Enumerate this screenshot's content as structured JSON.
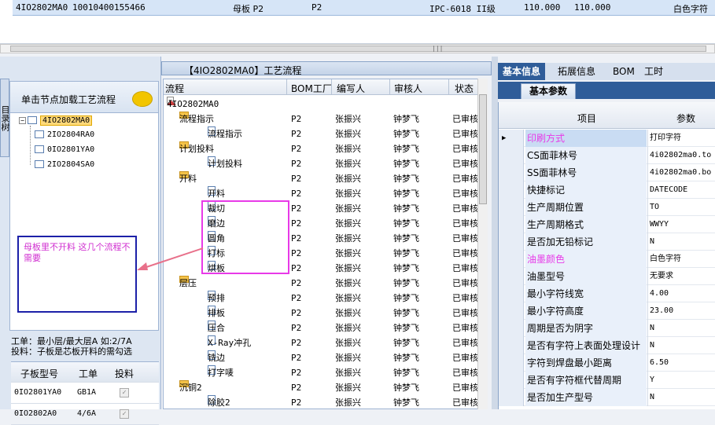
{
  "top_row": {
    "cells": [
      "4IO2802MA0",
      "10010400155466",
      "母板 P2",
      "P2",
      "IPC-6018 II级",
      "110.000",
      "110.000",
      "白色字符"
    ]
  },
  "scrollbar_grip": "|||",
  "left_panel": {
    "vertical_tab": "目录树",
    "header": "单击节点加载工艺流程",
    "tree": [
      "4IO2802MA0",
      "2IO2804RA0",
      "0IO2801YA0",
      "2IO2804SA0"
    ],
    "note": "母板里不开料 这几个流程不需要",
    "info_line1": "工单：最小层/最大层A 如:2/7A",
    "info_line2": "投料：子板是芯板开料的需勾选",
    "table": {
      "headers": [
        "子板型号",
        "工单",
        "投料"
      ],
      "rows": [
        [
          "0IO2801YA0",
          "GB1A",
          "✓"
        ],
        [
          "0IO2802A0",
          "4/6A",
          "✓"
        ]
      ]
    }
  },
  "middle": {
    "title": "【4IO2802MA0】工艺流程",
    "headers": [
      "流程",
      "BOM工厂",
      "编写人",
      "审核人",
      "状态"
    ],
    "root": "4IO2802MA0",
    "rows": [
      {
        "type": "folder",
        "name": "流程指示",
        "bom": "P2",
        "author": "张振兴",
        "reviewer": "钟梦飞",
        "status": "已审核"
      },
      {
        "type": "doc",
        "name": "流程指示",
        "bom": "P2",
        "author": "张振兴",
        "reviewer": "钟梦飞",
        "status": "已审核"
      },
      {
        "type": "folder",
        "name": "计划投料",
        "bom": "P2",
        "author": "张振兴",
        "reviewer": "钟梦飞",
        "status": "已审核"
      },
      {
        "type": "doc",
        "name": "计划投料",
        "bom": "P2",
        "author": "张振兴",
        "reviewer": "钟梦飞",
        "status": "已审核"
      },
      {
        "type": "folder",
        "name": "开料",
        "bom": "P2",
        "author": "张振兴",
        "reviewer": "钟梦飞",
        "status": "已审核"
      },
      {
        "type": "doc",
        "name": "开料",
        "bom": "P2",
        "author": "张振兴",
        "reviewer": "钟梦飞",
        "status": "已审核"
      },
      {
        "type": "doc",
        "name": "裁切",
        "bom": "P2",
        "author": "张振兴",
        "reviewer": "钟梦飞",
        "status": "已审核"
      },
      {
        "type": "doc",
        "name": "磨边",
        "bom": "P2",
        "author": "张振兴",
        "reviewer": "钟梦飞",
        "status": "已审核"
      },
      {
        "type": "doc",
        "name": "圆角",
        "bom": "P2",
        "author": "张振兴",
        "reviewer": "钟梦飞",
        "status": "已审核"
      },
      {
        "type": "doc",
        "name": "打标",
        "bom": "P2",
        "author": "张振兴",
        "reviewer": "钟梦飞",
        "status": "已审核"
      },
      {
        "type": "doc",
        "name": "烘板",
        "bom": "P2",
        "author": "张振兴",
        "reviewer": "钟梦飞",
        "status": "已审核"
      },
      {
        "type": "folder",
        "name": "层压",
        "bom": "P2",
        "author": "张振兴",
        "reviewer": "钟梦飞",
        "status": "已审核"
      },
      {
        "type": "doc",
        "name": "预排",
        "bom": "P2",
        "author": "张振兴",
        "reviewer": "钟梦飞",
        "status": "已审核"
      },
      {
        "type": "doc",
        "name": "排板",
        "bom": "P2",
        "author": "张振兴",
        "reviewer": "钟梦飞",
        "status": "已审核"
      },
      {
        "type": "doc",
        "name": "压合",
        "bom": "P2",
        "author": "张振兴",
        "reviewer": "钟梦飞",
        "status": "已审核"
      },
      {
        "type": "doc",
        "name": "X-Ray冲孔",
        "bom": "P2",
        "author": "张振兴",
        "reviewer": "钟梦飞",
        "status": "已审核"
      },
      {
        "type": "doc",
        "name": "铣边",
        "bom": "P2",
        "author": "张振兴",
        "reviewer": "钟梦飞",
        "status": "已审核"
      },
      {
        "type": "doc",
        "name": "打字唛",
        "bom": "P2",
        "author": "张振兴",
        "reviewer": "钟梦飞",
        "status": "已审核"
      },
      {
        "type": "folder",
        "name": "沉铜2",
        "bom": "P2",
        "author": "张振兴",
        "reviewer": "钟梦飞",
        "status": "已审核"
      },
      {
        "type": "doc",
        "name": "除胶2",
        "bom": "P2",
        "author": "张振兴",
        "reviewer": "钟梦飞",
        "status": "已审核"
      }
    ]
  },
  "right": {
    "tabs": [
      "基本信息",
      "拓展信息",
      "BOM",
      "工时"
    ],
    "subtab": "基本参数",
    "headers": [
      "项目",
      "参数"
    ],
    "rows": [
      {
        "k": "印刷方式",
        "v": "打印字符",
        "pink": true
      },
      {
        "k": "CS面菲林号",
        "v": "4i02802ma0.to"
      },
      {
        "k": "SS面菲林号",
        "v": "4i02802ma0.bo"
      },
      {
        "k": "快捷标记",
        "v": "DATECODE"
      },
      {
        "k": "生产周期位置",
        "v": "TO"
      },
      {
        "k": "生产周期格式",
        "v": "WWYY"
      },
      {
        "k": "是否加无铅标记",
        "v": "N"
      },
      {
        "k": "油墨颜色",
        "v": "白色字符",
        "pink": true
      },
      {
        "k": "油墨型号",
        "v": "无要求"
      },
      {
        "k": "最小字符线宽",
        "v": "4.00"
      },
      {
        "k": "最小字符高度",
        "v": "23.00"
      },
      {
        "k": "周期是否为阴字",
        "v": "N"
      },
      {
        "k": "是否有字符上表面处理设计",
        "v": "N"
      },
      {
        "k": "字符到焊盘最小距离",
        "v": "6.50"
      },
      {
        "k": "是否有字符框代替周期",
        "v": "Y"
      },
      {
        "k": "是否加生产型号",
        "v": "N"
      }
    ]
  },
  "colors": {
    "accent": "#2f5d99",
    "pink": "#e83ae8",
    "note_border": "#1c20a8"
  }
}
